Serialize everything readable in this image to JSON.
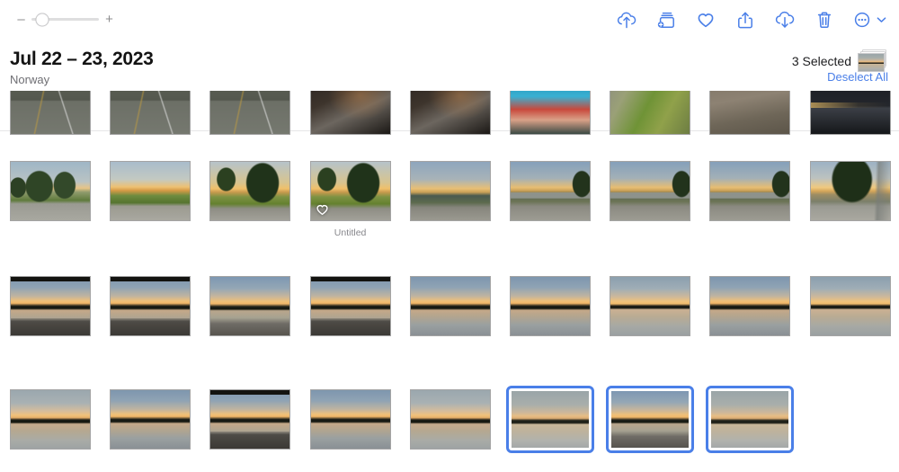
{
  "app": {
    "accent_color": "#4a7fe8",
    "background": "#ffffff"
  },
  "toolbar": {
    "zoom_slider": {
      "decrease_label": "–",
      "increase_label": "+",
      "value_percent": 16
    },
    "actions": [
      {
        "name": "upload-to-icloud-icon",
        "label": "Upload"
      },
      {
        "name": "add-to-album-icon",
        "label": "Add To Album"
      },
      {
        "name": "favorite-heart-icon",
        "label": "Favorite"
      },
      {
        "name": "share-icon",
        "label": "Share"
      },
      {
        "name": "download-from-icloud-icon",
        "label": "Download"
      },
      {
        "name": "delete-trash-icon",
        "label": "Delete"
      },
      {
        "name": "more-options-icon",
        "label": "More"
      }
    ]
  },
  "header": {
    "date_title": "Jul 22 – 23, 2023",
    "location": "Norway",
    "selected_count_label": "3 Selected",
    "deselect_all_label": "Deselect All"
  },
  "grid": {
    "columns": 9,
    "rows": [
      {
        "row_index": 0,
        "clipped_top": true,
        "photos": [
          {
            "scene": "sc-road",
            "caption": "",
            "favorite": false,
            "selected": false
          },
          {
            "scene": "sc-road",
            "caption": "",
            "favorite": false,
            "selected": false
          },
          {
            "scene": "sc-road",
            "caption": "",
            "favorite": false,
            "selected": false
          },
          {
            "scene": "sc-dark",
            "caption": "",
            "favorite": false,
            "selected": false
          },
          {
            "scene": "sc-dark",
            "caption": "",
            "favorite": false,
            "selected": false
          },
          {
            "scene": "sc-kid",
            "caption": "",
            "favorite": false,
            "selected": false
          },
          {
            "scene": "sc-grass",
            "caption": "",
            "favorite": false,
            "selected": false
          },
          {
            "scene": "sc-path",
            "caption": "",
            "favorite": false,
            "selected": false
          },
          {
            "scene": "sc-nightfence",
            "caption": "",
            "favorite": false,
            "selected": false
          }
        ]
      },
      {
        "row_index": 1,
        "clipped_top": false,
        "photos": [
          {
            "scene": "sc-trees",
            "caption": "",
            "favorite": false,
            "selected": false
          },
          {
            "scene": "sc-trees-sun",
            "caption": "",
            "favorite": false,
            "selected": false
          },
          {
            "scene": "sc-bigtree",
            "caption": "",
            "favorite": false,
            "selected": false
          },
          {
            "scene": "sc-bigtree",
            "caption": "Untitled",
            "favorite": true,
            "selected": false
          },
          {
            "scene": "sc-camp",
            "caption": "",
            "favorite": false,
            "selected": false
          },
          {
            "scene": "sc-camp-bldg",
            "caption": "",
            "favorite": false,
            "selected": false
          },
          {
            "scene": "sc-camp-bldg",
            "caption": "",
            "favorite": false,
            "selected": false
          },
          {
            "scene": "sc-camp-bldg",
            "caption": "",
            "favorite": false,
            "selected": false
          },
          {
            "scene": "sc-shore-tree",
            "caption": "",
            "favorite": false,
            "selected": false
          }
        ]
      },
      {
        "row_index": 2,
        "clipped_top": false,
        "photos": [
          {
            "scene": "sc-lake sc-lake-rail",
            "caption": "",
            "favorite": false,
            "selected": false
          },
          {
            "scene": "sc-lake sc-lake-rail",
            "caption": "",
            "favorite": false,
            "selected": false
          },
          {
            "scene": "sc-lake-road",
            "caption": "",
            "favorite": false,
            "selected": false
          },
          {
            "scene": "sc-lake sc-lake-rail",
            "caption": "",
            "favorite": false,
            "selected": false
          },
          {
            "scene": "sc-lake sc-lake-bush",
            "caption": "",
            "favorite": false,
            "selected": false
          },
          {
            "scene": "sc-lake sc-lake-bush",
            "caption": "",
            "favorite": false,
            "selected": false
          },
          {
            "scene": "sc-lake-plain",
            "caption": "",
            "favorite": false,
            "selected": false
          },
          {
            "scene": "sc-lake sc-lake-overhang",
            "caption": "",
            "favorite": false,
            "selected": false
          },
          {
            "scene": "sc-lake-plain",
            "caption": "",
            "favorite": false,
            "selected": false
          }
        ]
      },
      {
        "row_index": 3,
        "clipped_top": false,
        "photos": [
          {
            "scene": "sc-lake-hills",
            "caption": "",
            "favorite": false,
            "selected": false
          },
          {
            "scene": "sc-lake sc-lake-bush",
            "caption": "",
            "favorite": false,
            "selected": false
          },
          {
            "scene": "sc-lake sc-lake-rail",
            "caption": "",
            "favorite": false,
            "selected": false
          },
          {
            "scene": "sc-lake sc-lake-bush",
            "caption": "",
            "favorite": false,
            "selected": false
          },
          {
            "scene": "sc-lake-hills",
            "caption": "",
            "favorite": false,
            "selected": false
          },
          {
            "scene": "sc-lake-dim",
            "caption": "",
            "favorite": false,
            "selected": true
          },
          {
            "scene": "sc-lake-road",
            "caption": "",
            "favorite": false,
            "selected": true
          },
          {
            "scene": "sc-lake-dim",
            "caption": "",
            "favorite": false,
            "selected": true
          }
        ]
      }
    ]
  }
}
